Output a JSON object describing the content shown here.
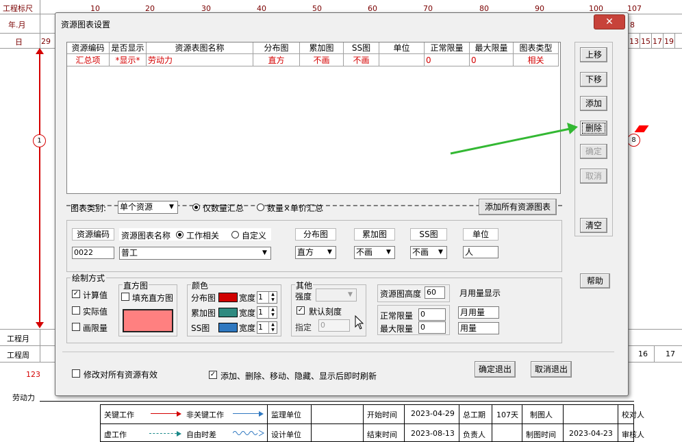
{
  "background": {
    "ruler_label": "工程标尺",
    "year_month_label": "年.月",
    "day_label": "日",
    "ruler_numbers": [
      "10",
      "20",
      "30",
      "40",
      "50",
      "60",
      "70",
      "80",
      "90",
      "100",
      "107"
    ],
    "day_left": "29",
    "day_right": [
      "8"
    ],
    "day_right2": [
      "13",
      "15",
      "17",
      "19"
    ],
    "node_1": "1",
    "node_8": "8",
    "project_month_label": "工程月",
    "project_week_label": "工程周",
    "week_right": [
      "16",
      "17"
    ],
    "count_label": "123",
    "labor_label": "劳动力",
    "legend": {
      "key_work": "关键工作",
      "non_key_work": "非关键工作",
      "virtual_work": "虚工作",
      "free_float": "自由时差"
    },
    "footer": {
      "supervisor": "监理单位",
      "designer": "设计单位",
      "start_label": "开始时间",
      "start_value": "2023-04-29",
      "end_label": "结束时间",
      "end_value": "2023-08-13",
      "total_period_label": "总工期",
      "total_period_value": "107天",
      "responsible_label": "负责人",
      "drawer_label": "制图人",
      "draw_time_label": "制图时间",
      "draw_time_value": "2023-04-23",
      "checker_label": "校对人",
      "reviewer_label": "审核人"
    }
  },
  "dialog": {
    "title": "资源图表设置",
    "close": "✕",
    "table": {
      "headers": [
        "资源编码",
        "是否显示",
        "资源表图名称",
        "分布图",
        "累加图",
        "SS图",
        "单位",
        "正常限量",
        "最大限量",
        "图表类型"
      ],
      "rows": [
        [
          "汇总项",
          "*显示*",
          "劳动力",
          "直方",
          "不画",
          "不画",
          "",
          "0",
          "0",
          "相关"
        ]
      ]
    },
    "side_buttons": {
      "up": "上移",
      "down": "下移",
      "add": "添加",
      "delete": "删除",
      "confirm": "确定",
      "cancel": "取消",
      "clear": "清空",
      "help": "帮助"
    },
    "chart_category_label": "图表类别:",
    "chart_category_value": "单个资源",
    "radio_qty_only": "仅数量汇总",
    "radio_qty_price": "数量×单价汇总",
    "add_all_button": "添加所有资源图表",
    "res_code_label": "资源编码",
    "res_code_value": "0022",
    "res_chart_name_label": "资源图表名称",
    "radio_work_related": "工作相关",
    "radio_custom": "自定义",
    "res_chart_name_value": "普工",
    "dist_label": "分布图",
    "dist_value": "直方",
    "cum_label": "累加图",
    "cum_value": "不画",
    "ss_label": "SS图",
    "ss_value": "不画",
    "unit_label": "单位",
    "unit_value": "人",
    "draw_mode_label": "绘制方式",
    "calc_value": "计算值",
    "actual_value": "实际值",
    "draw_limit": "画限量",
    "histogram_label": "直方图",
    "fill_histogram": "填充直方图",
    "color_label": "颜色",
    "dist_color_label": "分布图",
    "cum_color_label": "累加图",
    "ss_color_label": "SS图",
    "width_label": "宽度",
    "width_value": "1",
    "other_label": "其他",
    "strength_label": "强度",
    "default_scale": "默认刻度",
    "specify_label": "指定",
    "specify_value": "0",
    "res_height_label": "资源图高度",
    "res_height_value": "60",
    "monthly_display_label": "月用量显示",
    "normal_limit_label": "正常限量",
    "normal_limit_value": "0",
    "max_limit_label": "最大限量",
    "max_limit_value": "0",
    "monthly_usage_value": "月用量",
    "usage_value": "用量",
    "modify_all": "修改对所有资源有效",
    "refresh_immediately": "添加、删除、移动、隐藏、显示后即时刷新",
    "ok_exit": "确定退出",
    "cancel_exit": "取消退出",
    "colors": {
      "histogram_fill": "#ff8080",
      "dist": "#d00000",
      "cum": "#2f8a80",
      "ss": "#2f78c0",
      "accent_red": "#d40000",
      "arrow_green": "#33b833"
    }
  }
}
